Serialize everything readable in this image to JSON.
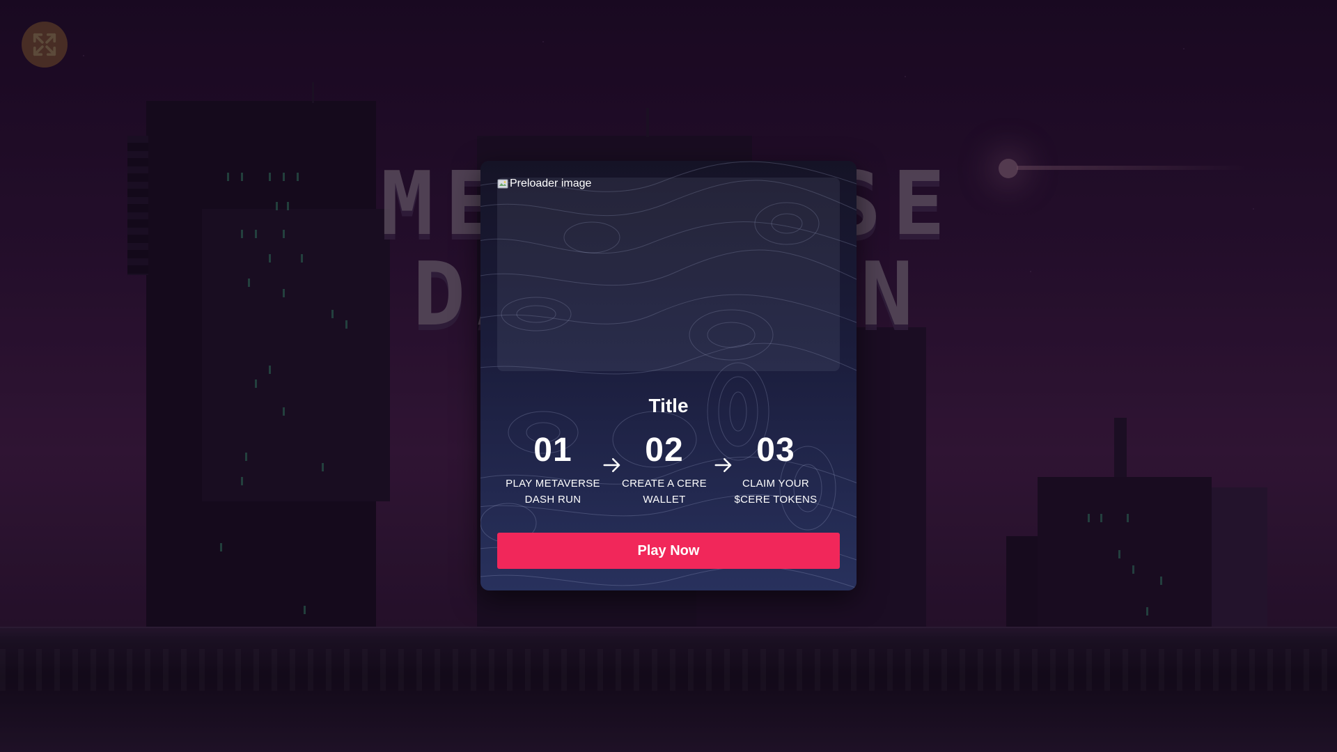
{
  "fullscreen_button": {
    "icon": "expand-icon"
  },
  "background": {
    "logo_text_line1": "METAVERSE",
    "logo_text_line2": "DASH RUN"
  },
  "modal": {
    "preloader_alt": "Preloader image",
    "title": "Title",
    "steps": [
      {
        "number": "01",
        "label_line1": "PLAY METAVERSE",
        "label_line2": "DASH RUN"
      },
      {
        "number": "02",
        "label_line1": "CREATE A CERE",
        "label_line2": "WALLET"
      },
      {
        "number": "03",
        "label_line1": "CLAIM YOUR",
        "label_line2": "$CERE TOKENS"
      }
    ],
    "play_button": "Play Now"
  },
  "colors": {
    "accent": "#f1275a",
    "modal_top": "#151326",
    "modal_bottom": "#28315d",
    "text": "#ffffff"
  }
}
